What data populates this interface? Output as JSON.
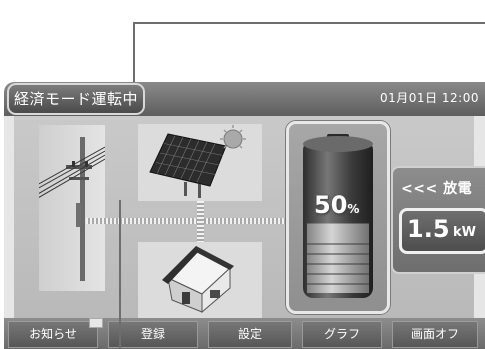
{
  "status": {
    "mode": "経済モード運転中",
    "date": "01月01日",
    "time": "12:00"
  },
  "battery": {
    "level_percent": 50,
    "value_text": "50",
    "unit": "%"
  },
  "discharge": {
    "label": "<<< 放電",
    "power_value": "1.5",
    "power_unit": "kW"
  },
  "menu": [
    {
      "label": "お知らせ"
    },
    {
      "label": "登録"
    },
    {
      "label": "設定"
    },
    {
      "label": "グラフ"
    },
    {
      "label": "画面オフ"
    }
  ],
  "icons": {
    "grid": "utility-pole-icon",
    "solar": "solar-panel-icon",
    "sun": "sun-icon",
    "home": "house-icon",
    "battery": "battery-icon",
    "notice": "envelope-icon"
  },
  "colors": {
    "frame": "#5e5e5e",
    "panel": "#c2c2c2",
    "text": "#ffffff"
  }
}
